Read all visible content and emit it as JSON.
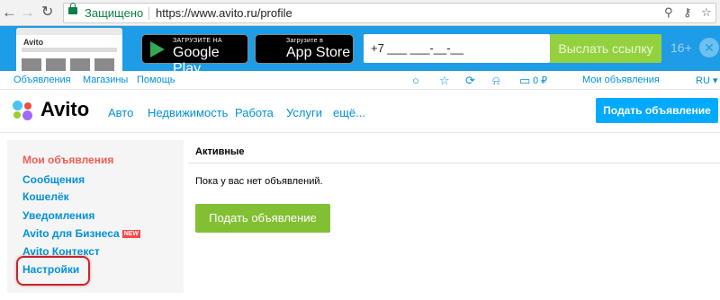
{
  "browser": {
    "security_label": "Защищено",
    "url": "https://www.avito.ru/profile"
  },
  "banner": {
    "google_play_small": "ЗАГРУЗИТЕ НА",
    "google_play_big": "Google Play",
    "app_store_small": "Загрузите в",
    "app_store_big": "App Store",
    "phone_value": "+7 ___ ___-__-__",
    "send_link_label": "Выслать ссылку",
    "age_rating": "16+",
    "close_glyph": "✕",
    "phone_preview_logo": "Avito"
  },
  "top_links": {
    "ads": "Объявления",
    "shops": "Магазины",
    "help": "Помощь",
    "wallet_amount": "0 ₽",
    "my_ads": "Мои объявления",
    "language": "RU ▾"
  },
  "header": {
    "logo": "Avito",
    "categories": [
      "Авто",
      "Недвижимость",
      "Работа",
      "Услуги",
      "ещё..."
    ],
    "post_button": "Подать объявление"
  },
  "sidebar": {
    "items": [
      {
        "label": "Мои объявления",
        "active": true
      },
      {
        "label": "Сообщения"
      },
      {
        "label": "Кошелёк"
      },
      {
        "label": "Уведомления"
      },
      {
        "label": "Avito для Бизнеса",
        "badge": "NEW"
      },
      {
        "label": "Avito Контекст"
      },
      {
        "label": "Настройки",
        "highlighted": true
      }
    ]
  },
  "main": {
    "tab_label": "Активные",
    "empty_message": "Пока у вас нет объявлений.",
    "post_button": "Подать объявление"
  },
  "colors": {
    "banner": "#1e9ce5",
    "link": "#0091d9",
    "active_item": "#f25c54",
    "green_button": "#82bf33",
    "blue_button": "#00aaff",
    "highlight": "#c6252e"
  },
  "icons": [
    "back-arrow-icon",
    "forward-arrow-icon",
    "reload-icon",
    "lock-icon",
    "zoom-icon",
    "key-icon",
    "star-icon",
    "apple-icon",
    "google-play-icon",
    "chat-icon",
    "favorite-icon",
    "compare-icon",
    "bell-icon",
    "wallet-icon"
  ]
}
